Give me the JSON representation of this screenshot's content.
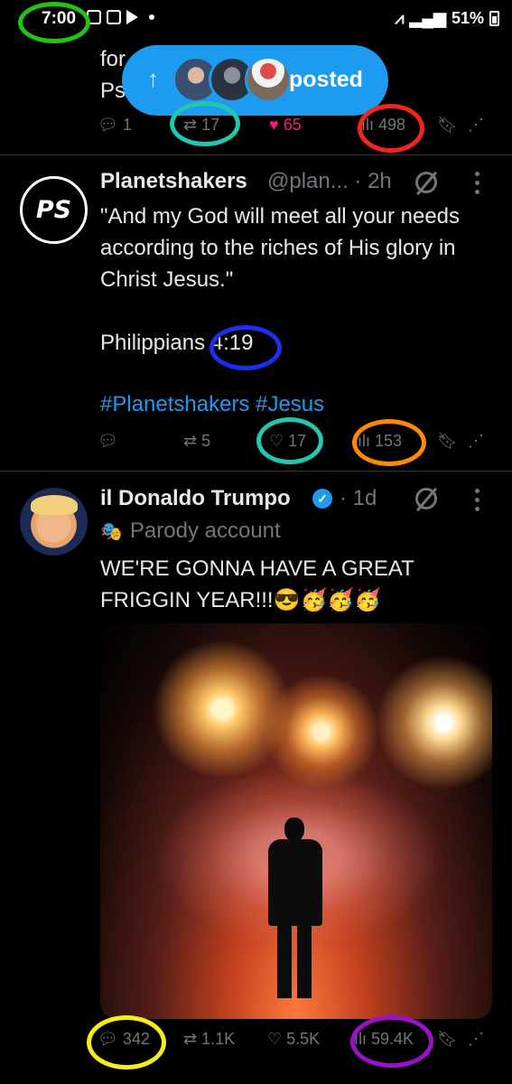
{
  "status_bar": {
    "time": "7:00",
    "battery": "51%"
  },
  "top_tweet": {
    "text_line1": "for",
    "text_line2": "Ps",
    "pill_label": "posted",
    "stats": {
      "replies": "1",
      "reposts": "17",
      "likes": "65",
      "views": "498"
    }
  },
  "tweet_planetshakers": {
    "avatar_text": "PS",
    "name": "Planetshakers",
    "handle": "@plan... · 2h",
    "body_lines": [
      "\"And my God will meet all your needs",
      "according to the riches of His glory in",
      "Christ Jesus.\""
    ],
    "verse": "Philippians 4:19",
    "hashtags": "#Planetshakers #Jesus",
    "stats": {
      "reposts": "5",
      "likes": "17",
      "views": "153"
    }
  },
  "tweet_trumpo": {
    "name": "il Donaldo Trumpo",
    "time": "· 1d",
    "parody_label": "Parody account",
    "body_lines": [
      "WE'RE GONNA HAVE A GREAT",
      "FRIGGIN YEAR!!!😎🥳🥳🥳"
    ],
    "stats": {
      "replies": "342",
      "reposts": "1.1K",
      "likes": "5.5K",
      "views": "59.4K"
    }
  },
  "colors": {
    "accent": "#1d9bf0",
    "like": "#f91880",
    "muted": "#71767b"
  }
}
